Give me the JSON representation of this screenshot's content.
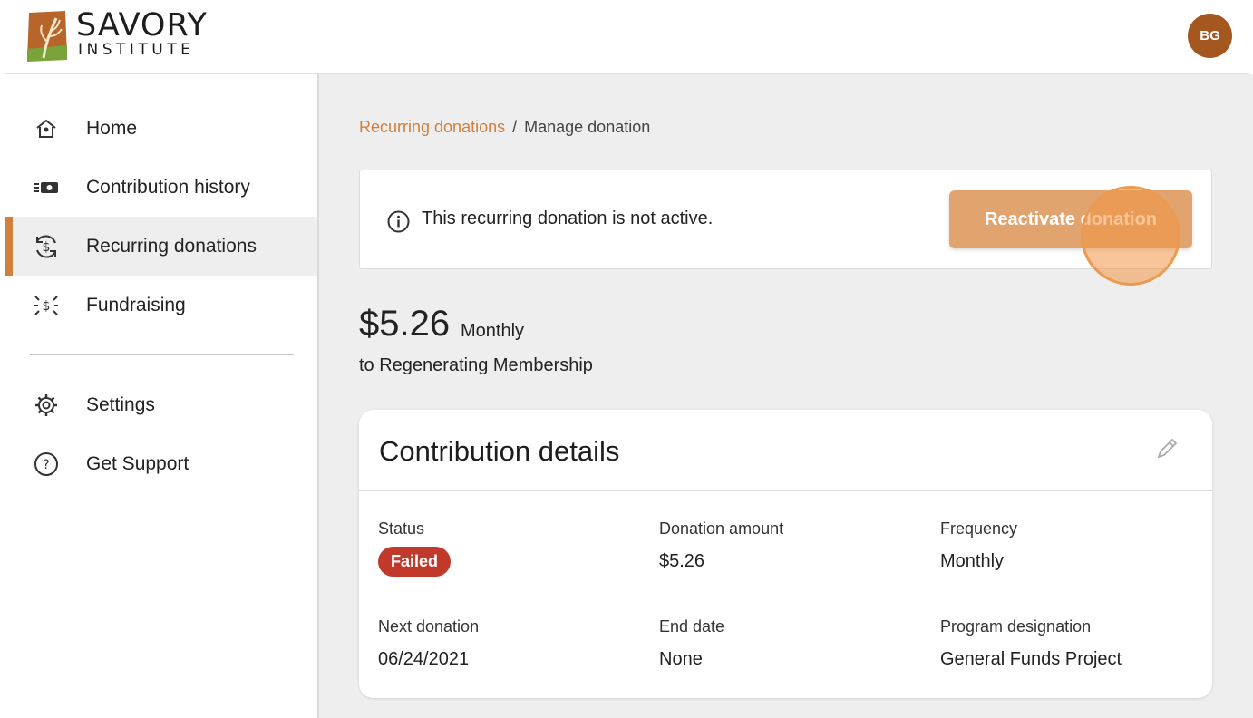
{
  "header": {
    "logo_line1": "SAVORY",
    "logo_line2": "INSTITUTE",
    "avatar_initials": "BG"
  },
  "sidebar": {
    "items": [
      {
        "label": "Home",
        "icon": "home-icon"
      },
      {
        "label": "Contribution history",
        "icon": "cash-icon"
      },
      {
        "label": "Recurring donations",
        "icon": "recurring-dollar-icon",
        "active": true
      },
      {
        "label": "Fundraising",
        "icon": "fundraising-icon"
      },
      {
        "label": "Settings",
        "icon": "gear-icon"
      },
      {
        "label": "Get Support",
        "icon": "help-icon"
      }
    ]
  },
  "breadcrumb": {
    "parent": "Recurring donations",
    "separator": "/",
    "current": "Manage donation"
  },
  "alert": {
    "message": "This recurring donation is not active.",
    "button_label": "Reactivate donation"
  },
  "summary": {
    "amount": "$5.26",
    "frequency": "Monthly",
    "to": "to Regenerating Membership"
  },
  "details": {
    "title": "Contribution details",
    "status_label": "Status",
    "status_value": "Failed",
    "amount_label": "Donation amount",
    "amount_value": "$5.26",
    "frequency_label": "Frequency",
    "frequency_value": "Monthly",
    "next_label": "Next donation",
    "next_value": "06/24/2021",
    "end_label": "End date",
    "end_value": "None",
    "program_label": "Program designation",
    "program_value": "General Funds Project"
  },
  "colors": {
    "accent": "#d0803c",
    "button": "#e2a46e",
    "failed": "#c0392b",
    "avatar": "#a4581f"
  }
}
